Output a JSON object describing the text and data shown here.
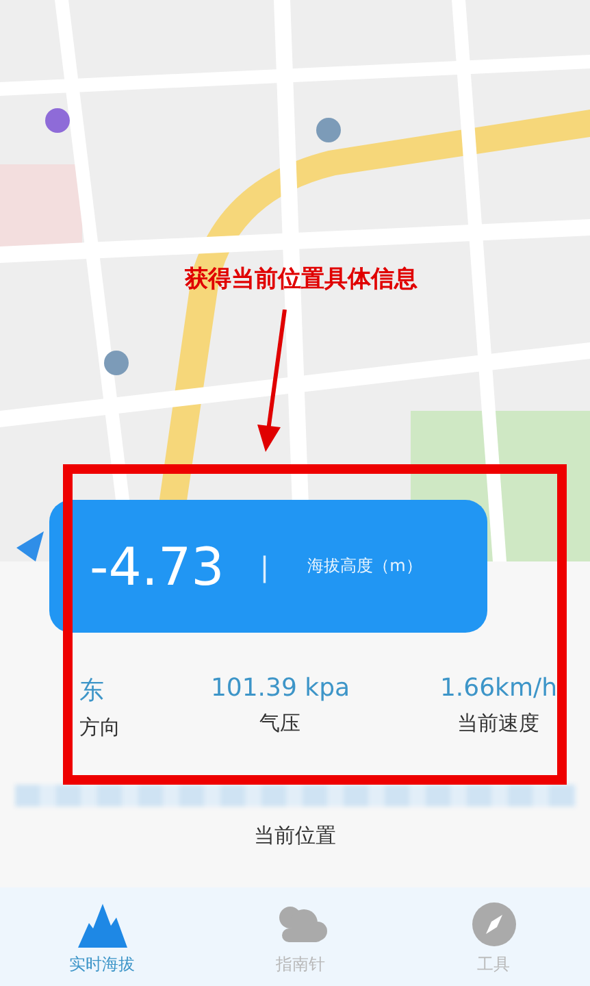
{
  "annotation": {
    "text": "获得当前位置具体信息"
  },
  "altitude": {
    "value": "-4.73",
    "separator": "|",
    "label": "海拔高度（m）"
  },
  "stats": [
    {
      "value": "东",
      "label": "方向"
    },
    {
      "value": "101.39 kpa",
      "label": "气压"
    },
    {
      "value": "1.66km/h",
      "label": "当前速度"
    }
  ],
  "location": {
    "label": "当前位置"
  },
  "nav": [
    {
      "label": "实时海拔",
      "kind": "mountain",
      "selected": true
    },
    {
      "label": "指南针",
      "kind": "cloud",
      "selected": false
    },
    {
      "label": "工具",
      "kind": "compass",
      "selected": false
    }
  ]
}
